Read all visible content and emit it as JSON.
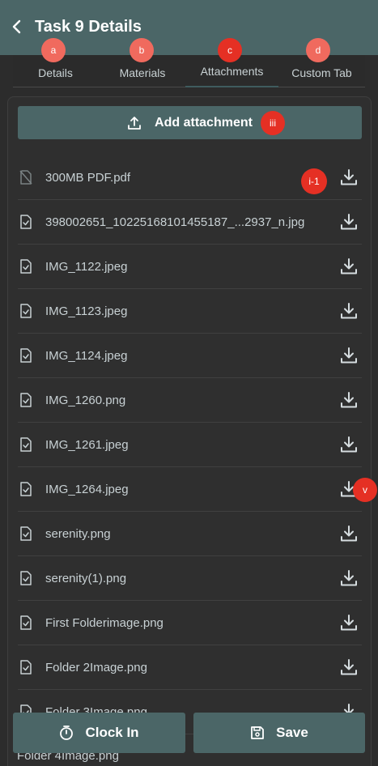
{
  "header": {
    "title": "Task 9 Details",
    "back_icon": "chevron-left-icon"
  },
  "tabs": [
    {
      "label": "Details",
      "marker": "a"
    },
    {
      "label": "Materials",
      "marker": "b"
    },
    {
      "label": "Attachments",
      "marker": "c",
      "active": true
    },
    {
      "label": "Custom Tab",
      "marker": "d"
    }
  ],
  "attachments": {
    "add_label": "Add attachment",
    "add_marker": "iii",
    "first_row_marker": "i-1",
    "side_marker": "v",
    "files": [
      {
        "name": "300MB PDF.pdf",
        "icon": "file-off-icon"
      },
      {
        "name": "398002651_10225168101455187_...2937_n.jpg",
        "icon": "file-check-icon"
      },
      {
        "name": "IMG_1122.jpeg",
        "icon": "file-check-icon"
      },
      {
        "name": "IMG_1123.jpeg",
        "icon": "file-check-icon"
      },
      {
        "name": "IMG_1124.jpeg",
        "icon": "file-check-icon"
      },
      {
        "name": "IMG_1260.png",
        "icon": "file-check-icon"
      },
      {
        "name": "IMG_1261.jpeg",
        "icon": "file-check-icon"
      },
      {
        "name": "IMG_1264.jpeg",
        "icon": "file-check-icon"
      },
      {
        "name": "serenity.png",
        "icon": "file-check-icon"
      },
      {
        "name": "serenity(1).png",
        "icon": "file-check-icon"
      },
      {
        "name": "First Folderimage.png",
        "icon": "file-check-icon"
      },
      {
        "name": "Folder 2Image.png",
        "icon": "file-check-icon"
      },
      {
        "name": "Folder 3Image.png",
        "icon": "file-check-icon"
      }
    ],
    "peek_name": "Folder 4Image.png"
  },
  "footer": {
    "clock_in_label": "Clock In",
    "save_label": "Save"
  },
  "colors": {
    "accent": "#4b6667",
    "marker": "#f05a50",
    "background": "#2c2c2c"
  }
}
